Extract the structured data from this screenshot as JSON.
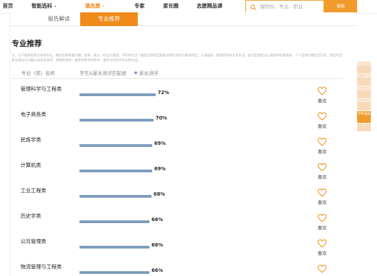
{
  "nav": {
    "items": [
      {
        "label": "首页",
        "active": false,
        "has_dropdown": false
      },
      {
        "label": "智能选科",
        "active": false,
        "has_dropdown": true
      },
      {
        "label": "填志愿",
        "active": true,
        "has_dropdown": true
      },
      {
        "label": "专家",
        "active": false,
        "has_dropdown": false
      },
      {
        "label": "家长圈",
        "active": false,
        "has_dropdown": false
      },
      {
        "label": "志愿精品课",
        "active": false,
        "has_dropdown": false
      }
    ],
    "search_placeholder": "搜院校、专业、职业",
    "search_button": "搜索"
  },
  "tabs": [
    {
      "label": "报告解读",
      "active": false
    },
    {
      "label": "专业推荐",
      "active": true
    }
  ],
  "section_title": "专业推荐",
  "note": "注：以下推荐结果为本科专业，推荐指数依据兴趣、性格、能力、职业价值观，学科依次五个维度对你的匹配情况进行加权计算后得出，分值越高，越值得你关注该专业，由于匹配度与心理测评结果相关，个人选择仍需结合实际，建议综合家长意见与兴趣以及在校成绩，请理性看待，推荐结果仅供参考，最终以你的实际志愿为准。",
  "table": {
    "col_name": "专业（类）名称",
    "col_match": "学生&家长测评匹配度",
    "legend": "家长测评",
    "like_label": "喜欢",
    "rows": [
      {
        "name": "管理科学与工程类",
        "percent": "72%",
        "value": 72
      },
      {
        "name": "电子商务类",
        "percent": "70%",
        "value": 70
      },
      {
        "name": "民族学类",
        "percent": "69%",
        "value": 69
      },
      {
        "name": "计算机类",
        "percent": "69%",
        "value": 69
      },
      {
        "name": "工业工程类",
        "percent": "68%",
        "value": 68
      },
      {
        "name": "历史学类",
        "percent": "66%",
        "value": 66
      },
      {
        "name": "公共管理类",
        "percent": "66%",
        "value": 66
      },
      {
        "name": "物流管理与工程类",
        "percent": "66%",
        "value": 66
      }
    ]
  },
  "side_panel": {
    "items": [
      {
        "label": "报告解读",
        "active": false
      },
      {
        "label": "专业推荐",
        "active": false
      },
      {
        "label": "职业推荐",
        "active": false
      },
      {
        "label": "院校推荐",
        "active": false
      },
      {
        "label": "学科强弱",
        "active": true
      }
    ],
    "top_label": "^"
  },
  "colors": {
    "accent": "#f08a1a",
    "bar": "#7d9cbc",
    "side_inactive": "#f8d9b8"
  },
  "icons": {
    "search": "search-icon",
    "like": "heart-outline-icon",
    "dropdown": "chevron-down-icon"
  }
}
